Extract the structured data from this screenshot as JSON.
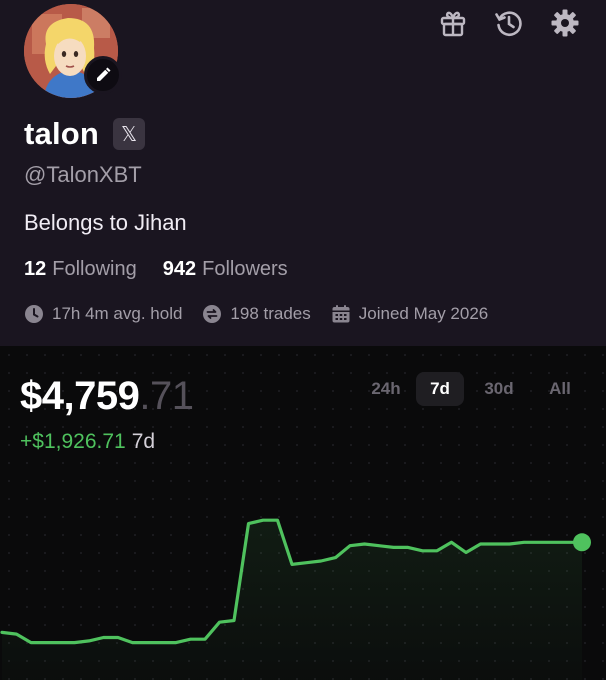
{
  "profile": {
    "name": "talon",
    "x_badge": "𝕏",
    "handle": "@TalonXBT",
    "bio": "Belongs to Jihan",
    "following_count": "12",
    "following_label": "Following",
    "followers_count": "942",
    "followers_label": "Followers",
    "stats": {
      "avg_hold": "17h 4m avg. hold",
      "trades": "198 trades",
      "joined": "Joined May 2026"
    },
    "icons": [
      "gift-icon",
      "history-icon",
      "gear-icon",
      "pencil-icon",
      "clock-icon",
      "swap-icon",
      "calendar-icon"
    ]
  },
  "wallet": {
    "balance_main": "$4,759",
    "balance_cents": ".71",
    "change": "+$1,926.71",
    "change_period": "7d",
    "ranges": [
      "24h",
      "7d",
      "30d",
      "All"
    ],
    "selected_range": "7d"
  },
  "colors": {
    "accent_green": "#4fc25e",
    "profile_bg": "#1a1520",
    "wallet_bg": "#0a0a0b"
  },
  "chart_data": {
    "type": "line",
    "title": "",
    "xlabel": "",
    "ylabel": "",
    "grid": false,
    "legend": "none",
    "series": [
      {
        "values": [
          0.08,
          0.07,
          0.02,
          0.02,
          0.02,
          0.02,
          0.03,
          0.05,
          0.05,
          0.02,
          0.02,
          0.02,
          0.02,
          0.04,
          0.04,
          0.14,
          0.15,
          0.72,
          0.74,
          0.74,
          0.48,
          0.49,
          0.5,
          0.52,
          0.59,
          0.6,
          0.59,
          0.58,
          0.58,
          0.56,
          0.56,
          0.61,
          0.55,
          0.6,
          0.6,
          0.6,
          0.61,
          0.61,
          0.61,
          0.61,
          0.61
        ]
      }
    ]
  }
}
